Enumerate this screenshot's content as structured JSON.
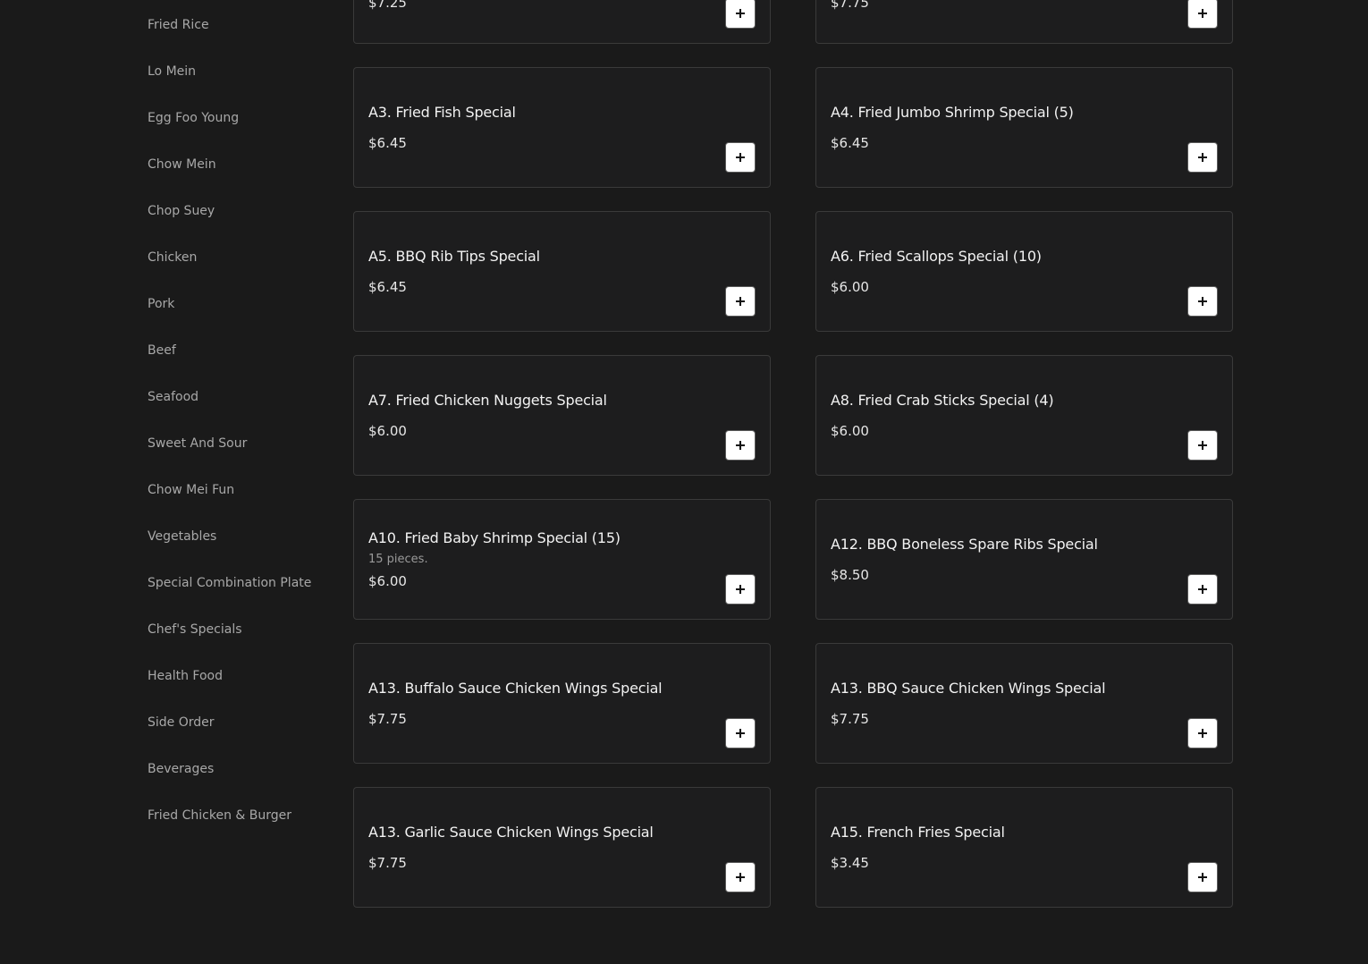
{
  "sidebar": {
    "categories": [
      "Fried Rice",
      "Lo Mein",
      "Egg Foo Young",
      "Chow Mein",
      "Chop Suey",
      "Chicken",
      "Pork",
      "Beef",
      "Seafood",
      "Sweet And Sour",
      "Chow Mei Fun",
      "Vegetables",
      "Special Combination Plate",
      "Chef's Specials",
      "Health Food",
      "Side Order",
      "Beverages",
      "Fried Chicken & Burger"
    ]
  },
  "menu": {
    "items": [
      {
        "name": "",
        "price": "$7.25",
        "desc": ""
      },
      {
        "name": "",
        "price": "$7.75",
        "desc": ""
      },
      {
        "name": "A3. Fried Fish Special",
        "price": "$6.45",
        "desc": ""
      },
      {
        "name": "A4. Fried Jumbo Shrimp Special (5)",
        "price": "$6.45",
        "desc": ""
      },
      {
        "name": "A5. BBQ Rib Tips Special",
        "price": "$6.45",
        "desc": ""
      },
      {
        "name": "A6. Fried Scallops Special (10)",
        "price": "$6.00",
        "desc": ""
      },
      {
        "name": "A7. Fried Chicken Nuggets Special",
        "price": "$6.00",
        "desc": ""
      },
      {
        "name": "A8. Fried Crab Sticks Special (4)",
        "price": "$6.00",
        "desc": ""
      },
      {
        "name": "A10. Fried Baby Shrimp Special (15)",
        "price": "$6.00",
        "desc": "15 pieces."
      },
      {
        "name": "A12. BBQ Boneless Spare Ribs Special",
        "price": "$8.50",
        "desc": ""
      },
      {
        "name": "A13. Buffalo Sauce Chicken Wings Special",
        "price": "$7.75",
        "desc": ""
      },
      {
        "name": "A13. BBQ Sauce Chicken Wings Special",
        "price": "$7.75",
        "desc": ""
      },
      {
        "name": "A13. Garlic Sauce Chicken Wings Special",
        "price": "$7.75",
        "desc": ""
      },
      {
        "name": "A15. French Fries Special",
        "price": "$3.45",
        "desc": ""
      }
    ],
    "add_icon": "plus-icon"
  }
}
